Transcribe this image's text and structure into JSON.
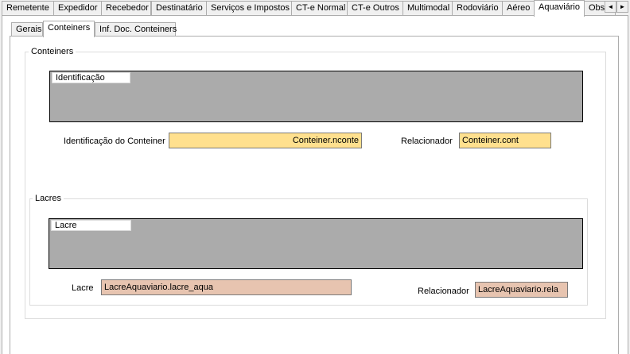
{
  "top_tabs": {
    "items": [
      {
        "label": "Remetente",
        "name": "tab-remetente"
      },
      {
        "label": "Expedidor",
        "name": "tab-expedidor"
      },
      {
        "label": "Recebedor",
        "name": "tab-recebedor"
      },
      {
        "label": "Destinatário",
        "name": "tab-destinatario"
      },
      {
        "label": "Serviços e Impostos",
        "name": "tab-servicos-impostos"
      },
      {
        "label": "CT-e Normal",
        "name": "tab-cte-normal"
      },
      {
        "label": "CT-e Outros",
        "name": "tab-cte-outros"
      },
      {
        "label": "Multimodal",
        "name": "tab-multimodal"
      },
      {
        "label": "Rodoviário",
        "name": "tab-rodoviario"
      },
      {
        "label": "Aéreo",
        "name": "tab-aereo"
      },
      {
        "label": "Aquaviário",
        "name": "tab-aquaviario"
      },
      {
        "label": "Obs",
        "name": "tab-obs"
      }
    ],
    "active": "Aquaviário",
    "scroll_left": "◄",
    "scroll_right": "►"
  },
  "inner_tabs": {
    "items": [
      {
        "label": "Gerais",
        "name": "tab-gerais"
      },
      {
        "label": "Conteiners",
        "name": "tab-conteiners"
      },
      {
        "label": "Inf. Doc. Conteiners",
        "name": "tab-inf-doc-conteiners"
      }
    ],
    "active": "Conteiners"
  },
  "conteiners": {
    "title": "Conteiners",
    "grid_header": "Identificação",
    "id_label": "Identificação do Conteiner",
    "id_value": "Conteiner.nconte",
    "rel_label": "Relacionador",
    "rel_value": "Conteiner.cont"
  },
  "lacres": {
    "title": "Lacres",
    "grid_header": "Lacre",
    "lacre_label": "Lacre",
    "lacre_value": "LacreAquaviario.lacre_aqua",
    "rel_label": "Relacionador",
    "rel_value": "LacreAquaviario.rela"
  },
  "colors": {
    "yellow_field": "#ffe08e",
    "salmon_field": "#e7c4b0",
    "grid_bg": "#ababab"
  }
}
